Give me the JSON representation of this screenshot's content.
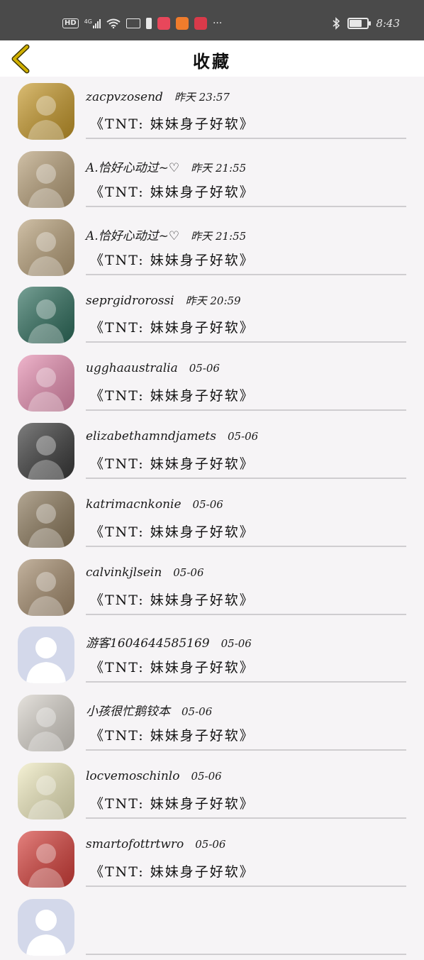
{
  "status_bar": {
    "left_chips": [
      "HD",
      "4G"
    ],
    "time": "8:43",
    "more": "···",
    "battery_level": 0.75,
    "icons": [
      "hd-icon",
      "signal-4g-icon",
      "wifi-icon",
      "sim-icon",
      "notification-icon",
      "app-red-icon",
      "app-orange-icon",
      "app-pink-icon",
      "bluetooth-icon",
      "battery-icon"
    ]
  },
  "header": {
    "title": "收藏",
    "back_icon": "chevron-left-icon",
    "accent": "#d1b000"
  },
  "items": [
    {
      "user": "zacpvzosend",
      "time": "昨天 23:57",
      "content": "《TNT: 妹妹身子好软》",
      "avatar": "skull",
      "color": "#c89a2a"
    },
    {
      "user": "A.恰好心动过~♡",
      "time": "昨天 21:55",
      "content": "《TNT: 妹妹身子好软》",
      "avatar": "boy",
      "color": "#b9a17a"
    },
    {
      "user": "A.恰好心动过~♡",
      "time": "昨天 21:55",
      "content": "《TNT: 妹妹身子好软》",
      "avatar": "boy",
      "color": "#b9a17a"
    },
    {
      "user": "seprgidrorossi",
      "time": "昨天 20:59",
      "content": "《TNT: 妹妹身子好软》",
      "avatar": "man",
      "color": "#2f6f5e"
    },
    {
      "user": "ugghaaustralia",
      "time": "05-06",
      "content": "《TNT: 妹妹身子好软》",
      "avatar": "comic",
      "color": "#e88fb2"
    },
    {
      "user": "elizabethamndjamets",
      "time": "05-06",
      "content": "《TNT: 妹妹身子好软》",
      "avatar": "bw",
      "color": "#3a3a3a"
    },
    {
      "user": "katrimacnkonie",
      "time": "05-06",
      "content": "《TNT: 妹妹身子好软》",
      "avatar": "lake",
      "color": "#8d7a5c"
    },
    {
      "user": "calvinkjlsein",
      "time": "05-06",
      "content": "《TNT: 妹妹身子好软》",
      "avatar": "kid",
      "color": "#a68d6e"
    },
    {
      "user": "游客1604644585169",
      "time": "05-06",
      "content": "《TNT: 妹妹身子好软》",
      "avatar": "default",
      "color": "#d3d8ea"
    },
    {
      "user": "小孩很忙鹅铰本",
      "time": "05-06",
      "content": "《TNT: 妹妹身子好软》",
      "avatar": "cat",
      "color": "#d9d4cc"
    },
    {
      "user": "locvemoschinlo",
      "time": "05-06",
      "content": "《TNT: 妹妹身子好软》",
      "avatar": "dress",
      "color": "#f1ecc0"
    },
    {
      "user": "smartofottrtwro",
      "time": "05-06",
      "content": "《TNT: 妹妹身子好软》",
      "avatar": "cartoon",
      "color": "#d8403b"
    },
    {
      "user": "",
      "time": "",
      "content": "",
      "avatar": "default",
      "color": "#d3d8ea"
    }
  ]
}
